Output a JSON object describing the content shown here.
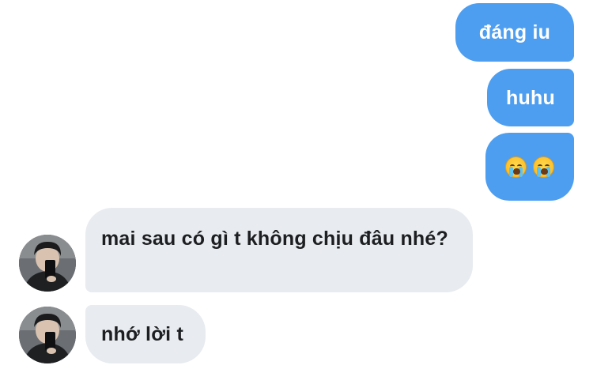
{
  "chat": {
    "messages": [
      {
        "sender": "me",
        "text": "đáng iu"
      },
      {
        "sender": "me",
        "text": "huhu"
      },
      {
        "sender": "me",
        "emojis": [
          "loudly-crying-face",
          "loudly-crying-face"
        ]
      },
      {
        "sender": "other",
        "text": "mai sau có gì t không chịu đâu nhé?"
      },
      {
        "sender": "other",
        "text": "nhớ lời t"
      }
    ]
  },
  "colors": {
    "outgoing_bubble": "#4d9ef0",
    "incoming_bubble": "#e8ebef",
    "outgoing_text": "#ffffff",
    "incoming_text": "#1c1e21"
  }
}
